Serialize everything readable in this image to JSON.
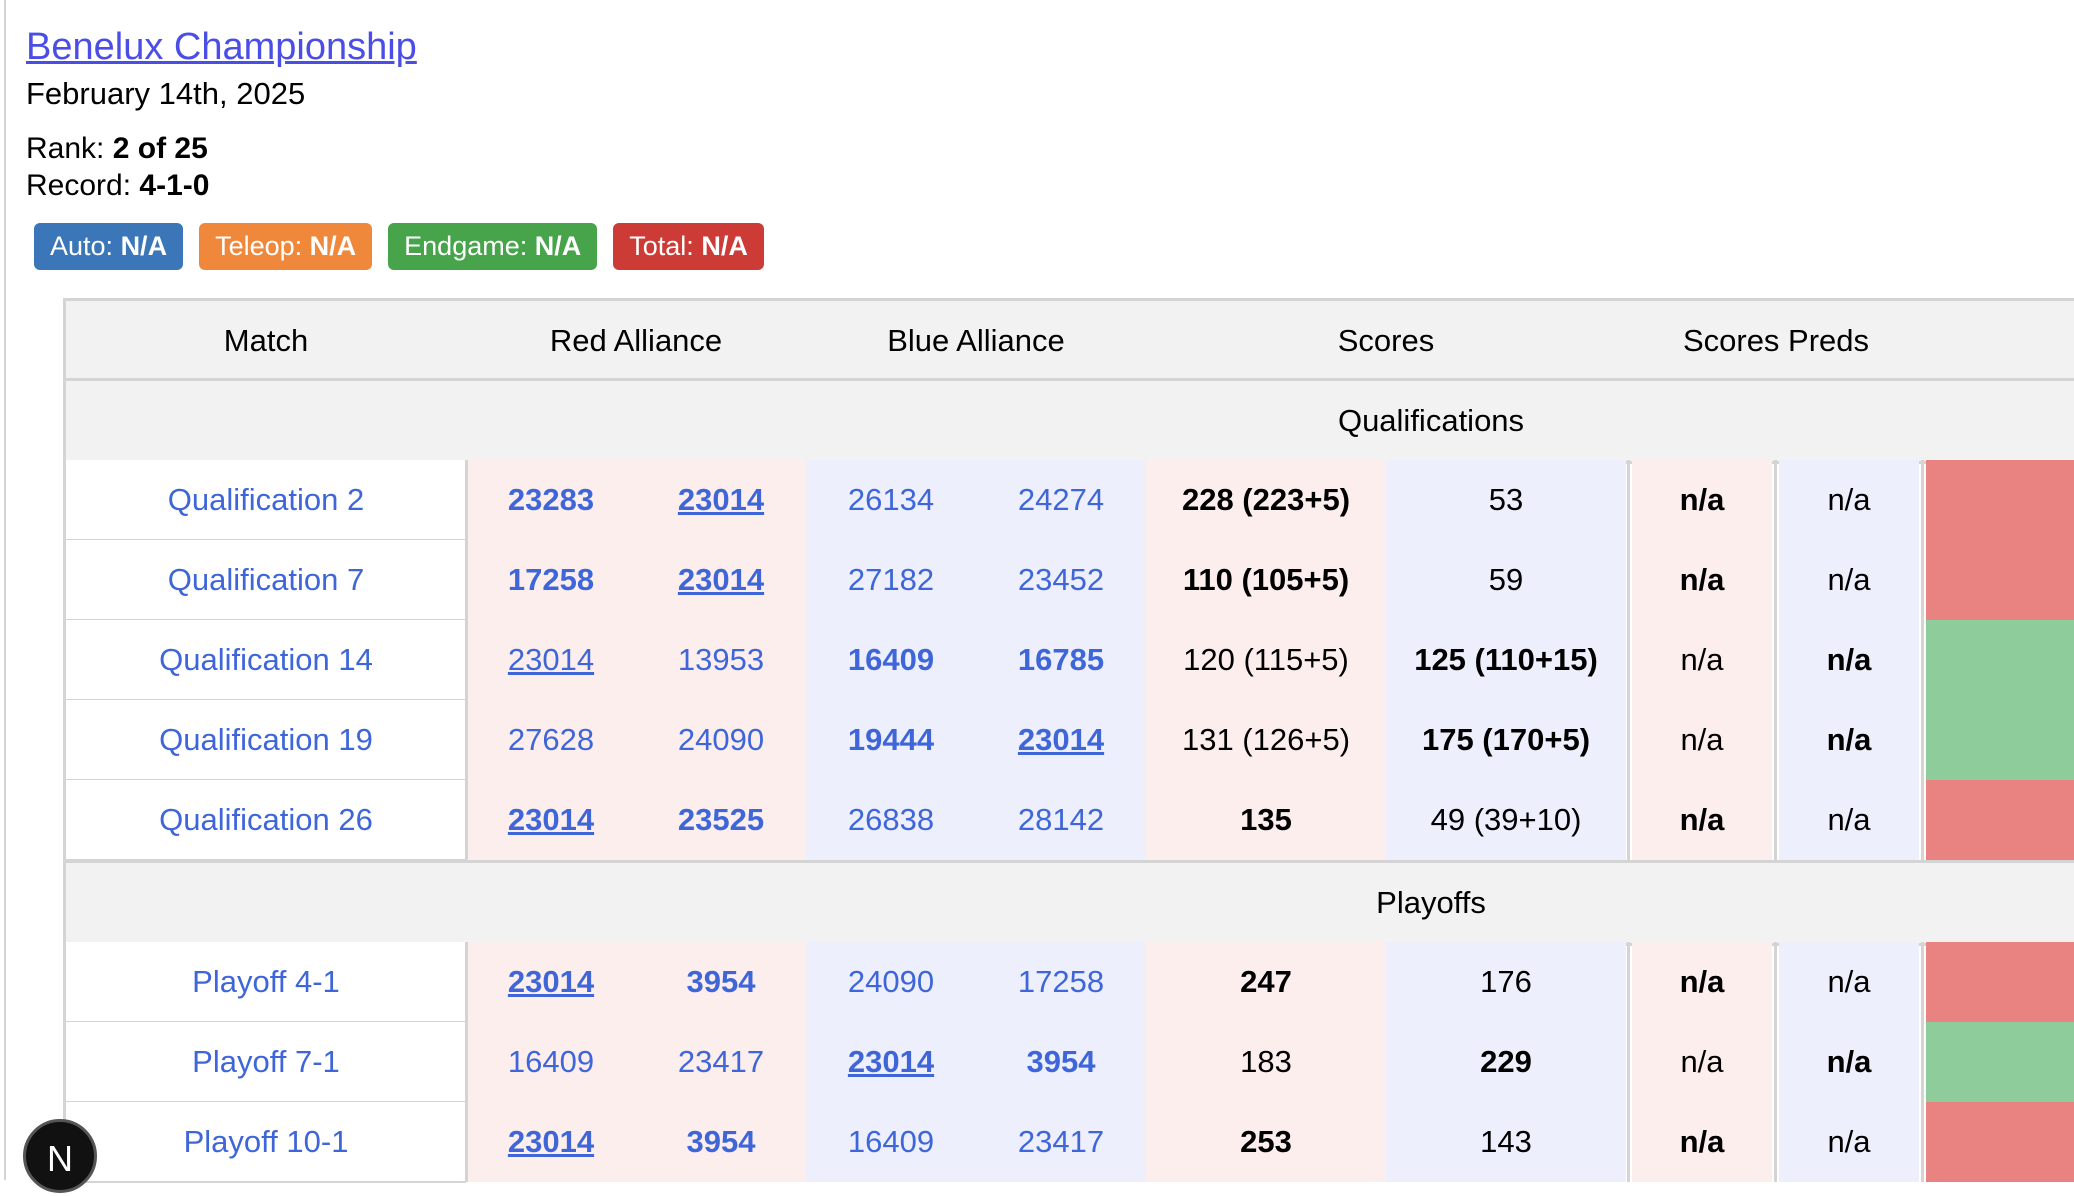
{
  "event": {
    "name": "Benelux Championship",
    "date": "February 14th, 2025",
    "rank_label": "Rank:",
    "rank_value": "2 of 25",
    "record_label": "Record:",
    "record_value": "4-1-0"
  },
  "badges": [
    {
      "label": "Auto:",
      "value": "N/A",
      "color": "#3a76b8"
    },
    {
      "label": "Teleop:",
      "value": "N/A",
      "color": "#f0883c"
    },
    {
      "label": "Endgame:",
      "value": "N/A",
      "color": "#47a44a"
    },
    {
      "label": "Total:",
      "value": "N/A",
      "color": "#cd3b36"
    }
  ],
  "table": {
    "headers": {
      "match": "Match",
      "red": "Red Alliance",
      "blue": "Blue Alliance",
      "scores": "Scores",
      "preds": "Scores Preds"
    },
    "sections": {
      "qual": "Qualifications",
      "playoff": "Playoffs"
    },
    "rows": [
      {
        "match": "Qualification 2",
        "red": [
          "23283",
          "23014"
        ],
        "blue": [
          "26134",
          "24274"
        ],
        "red_score": "228 (223+5)",
        "blue_score": "53",
        "red_pred": "n/a",
        "blue_pred": "n/a",
        "winner": "red",
        "result": "loss"
      },
      {
        "match": "Qualification 7",
        "red": [
          "17258",
          "23014"
        ],
        "blue": [
          "27182",
          "23452"
        ],
        "red_score": "110 (105+5)",
        "blue_score": "59",
        "red_pred": "n/a",
        "blue_pred": "n/a",
        "winner": "red",
        "result": "loss"
      },
      {
        "match": "Qualification 14",
        "red": [
          "23014",
          "13953"
        ],
        "blue": [
          "16409",
          "16785"
        ],
        "red_score": "120 (115+5)",
        "blue_score": "125 (110+15)",
        "red_pred": "n/a",
        "blue_pred": "n/a",
        "winner": "blue",
        "result": "win"
      },
      {
        "match": "Qualification 19",
        "red": [
          "27628",
          "24090"
        ],
        "blue": [
          "19444",
          "23014"
        ],
        "red_score": "131 (126+5)",
        "blue_score": "175 (170+5)",
        "red_pred": "n/a",
        "blue_pred": "n/a",
        "winner": "blue",
        "result": "win"
      },
      {
        "match": "Qualification 26",
        "red": [
          "23014",
          "23525"
        ],
        "blue": [
          "26838",
          "28142"
        ],
        "red_score": "135",
        "blue_score": "49 (39+10)",
        "red_pred": "n/a",
        "blue_pred": "n/a",
        "winner": "red",
        "result": "loss"
      },
      {
        "match": "Playoff 4-1",
        "red": [
          "23014",
          "3954"
        ],
        "blue": [
          "24090",
          "17258"
        ],
        "red_score": "247",
        "blue_score": "176",
        "red_pred": "n/a",
        "blue_pred": "n/a",
        "winner": "red",
        "result": "loss"
      },
      {
        "match": "Playoff 7-1",
        "red": [
          "16409",
          "23417"
        ],
        "blue": [
          "23014",
          "3954"
        ],
        "red_score": "183",
        "blue_score": "229",
        "red_pred": "n/a",
        "blue_pred": "n/a",
        "winner": "blue",
        "result": "win"
      },
      {
        "match": "Playoff 10-1",
        "red": [
          "23014",
          "3954"
        ],
        "blue": [
          "16409",
          "23417"
        ],
        "red_score": "253",
        "blue_score": "143",
        "red_pred": "n/a",
        "blue_pred": "n/a",
        "winner": "red",
        "result": "loss"
      }
    ],
    "highlight_team": "23014",
    "colors": {
      "win": "#8fcc9b",
      "loss": "#e88382",
      "red_tint": "#fdeeee",
      "blue_tint": "#eeeffd",
      "link": "#3e66d9"
    }
  },
  "nav": {
    "logo_letter": "N"
  }
}
